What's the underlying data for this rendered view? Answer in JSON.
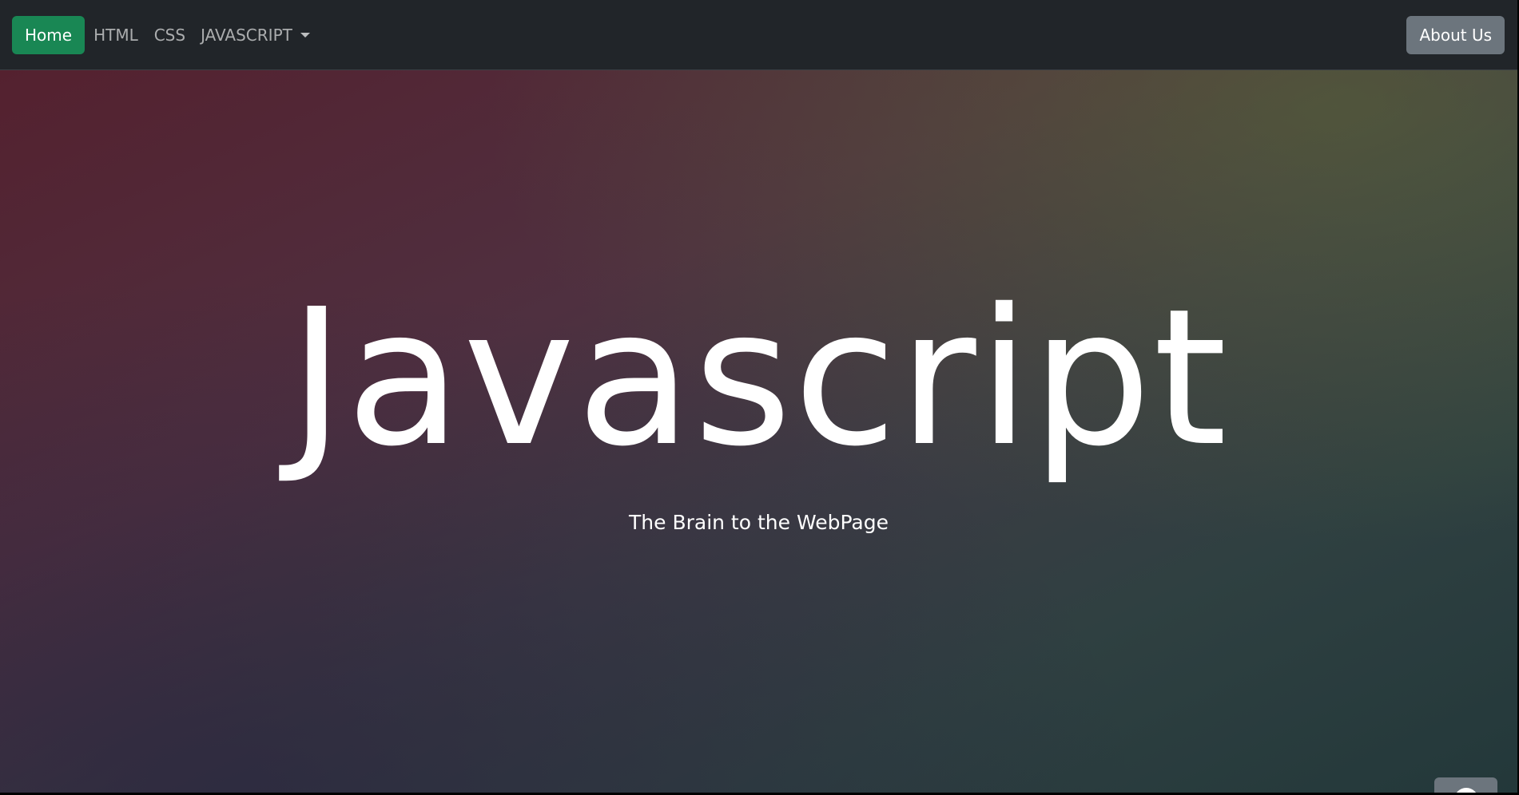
{
  "navbar": {
    "home_label": "Home",
    "links": [
      {
        "label": "HTML"
      },
      {
        "label": "CSS"
      }
    ],
    "dropdown_label": "JAVASCRIPT",
    "about_label": "About Us"
  },
  "hero": {
    "title": "Javascript",
    "subtitle": "The Brain to the WebPage"
  },
  "scroll_top": {
    "icon": "arrow-up-circle-icon"
  },
  "colors": {
    "navbar_bg": "#212529",
    "home_button": "#198754",
    "secondary_button": "#6c757d"
  }
}
